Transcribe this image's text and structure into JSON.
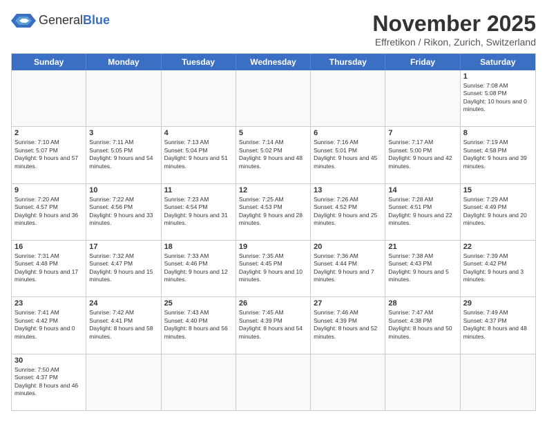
{
  "header": {
    "logo_general": "General",
    "logo_blue": "Blue",
    "month_title": "November 2025",
    "location": "Effretikon / Rikon, Zurich, Switzerland"
  },
  "days_of_week": [
    "Sunday",
    "Monday",
    "Tuesday",
    "Wednesday",
    "Thursday",
    "Friday",
    "Saturday"
  ],
  "weeks": [
    [
      {
        "day": "",
        "empty": true
      },
      {
        "day": "",
        "empty": true
      },
      {
        "day": "",
        "empty": true
      },
      {
        "day": "",
        "empty": true
      },
      {
        "day": "",
        "empty": true
      },
      {
        "day": "",
        "empty": true
      },
      {
        "day": "1",
        "sunrise": "7:08 AM",
        "sunset": "5:08 PM",
        "daylight": "10 hours and 0 minutes."
      }
    ],
    [
      {
        "day": "2",
        "sunrise": "7:10 AM",
        "sunset": "5:07 PM",
        "daylight": "9 hours and 57 minutes."
      },
      {
        "day": "3",
        "sunrise": "7:11 AM",
        "sunset": "5:05 PM",
        "daylight": "9 hours and 54 minutes."
      },
      {
        "day": "4",
        "sunrise": "7:13 AM",
        "sunset": "5:04 PM",
        "daylight": "9 hours and 51 minutes."
      },
      {
        "day": "5",
        "sunrise": "7:14 AM",
        "sunset": "5:02 PM",
        "daylight": "9 hours and 48 minutes."
      },
      {
        "day": "6",
        "sunrise": "7:16 AM",
        "sunset": "5:01 PM",
        "daylight": "9 hours and 45 minutes."
      },
      {
        "day": "7",
        "sunrise": "7:17 AM",
        "sunset": "5:00 PM",
        "daylight": "9 hours and 42 minutes."
      },
      {
        "day": "8",
        "sunrise": "7:19 AM",
        "sunset": "4:58 PM",
        "daylight": "9 hours and 39 minutes."
      }
    ],
    [
      {
        "day": "9",
        "sunrise": "7:20 AM",
        "sunset": "4:57 PM",
        "daylight": "9 hours and 36 minutes."
      },
      {
        "day": "10",
        "sunrise": "7:22 AM",
        "sunset": "4:56 PM",
        "daylight": "9 hours and 33 minutes."
      },
      {
        "day": "11",
        "sunrise": "7:23 AM",
        "sunset": "4:54 PM",
        "daylight": "9 hours and 31 minutes."
      },
      {
        "day": "12",
        "sunrise": "7:25 AM",
        "sunset": "4:53 PM",
        "daylight": "9 hours and 28 minutes."
      },
      {
        "day": "13",
        "sunrise": "7:26 AM",
        "sunset": "4:52 PM",
        "daylight": "9 hours and 25 minutes."
      },
      {
        "day": "14",
        "sunrise": "7:28 AM",
        "sunset": "4:51 PM",
        "daylight": "9 hours and 22 minutes."
      },
      {
        "day": "15",
        "sunrise": "7:29 AM",
        "sunset": "4:49 PM",
        "daylight": "9 hours and 20 minutes."
      }
    ],
    [
      {
        "day": "16",
        "sunrise": "7:31 AM",
        "sunset": "4:48 PM",
        "daylight": "9 hours and 17 minutes."
      },
      {
        "day": "17",
        "sunrise": "7:32 AM",
        "sunset": "4:47 PM",
        "daylight": "9 hours and 15 minutes."
      },
      {
        "day": "18",
        "sunrise": "7:33 AM",
        "sunset": "4:46 PM",
        "daylight": "9 hours and 12 minutes."
      },
      {
        "day": "19",
        "sunrise": "7:35 AM",
        "sunset": "4:45 PM",
        "daylight": "9 hours and 10 minutes."
      },
      {
        "day": "20",
        "sunrise": "7:36 AM",
        "sunset": "4:44 PM",
        "daylight": "9 hours and 7 minutes."
      },
      {
        "day": "21",
        "sunrise": "7:38 AM",
        "sunset": "4:43 PM",
        "daylight": "9 hours and 5 minutes."
      },
      {
        "day": "22",
        "sunrise": "7:39 AM",
        "sunset": "4:42 PM",
        "daylight": "9 hours and 3 minutes."
      }
    ],
    [
      {
        "day": "23",
        "sunrise": "7:41 AM",
        "sunset": "4:42 PM",
        "daylight": "9 hours and 0 minutes."
      },
      {
        "day": "24",
        "sunrise": "7:42 AM",
        "sunset": "4:41 PM",
        "daylight": "8 hours and 58 minutes."
      },
      {
        "day": "25",
        "sunrise": "7:43 AM",
        "sunset": "4:40 PM",
        "daylight": "8 hours and 56 minutes."
      },
      {
        "day": "26",
        "sunrise": "7:45 AM",
        "sunset": "4:39 PM",
        "daylight": "8 hours and 54 minutes."
      },
      {
        "day": "27",
        "sunrise": "7:46 AM",
        "sunset": "4:39 PM",
        "daylight": "8 hours and 52 minutes."
      },
      {
        "day": "28",
        "sunrise": "7:47 AM",
        "sunset": "4:38 PM",
        "daylight": "8 hours and 50 minutes."
      },
      {
        "day": "29",
        "sunrise": "7:49 AM",
        "sunset": "4:37 PM",
        "daylight": "8 hours and 48 minutes."
      }
    ],
    [
      {
        "day": "30",
        "sunrise": "7:50 AM",
        "sunset": "4:37 PM",
        "daylight": "8 hours and 46 minutes."
      },
      {
        "day": "",
        "empty": true
      },
      {
        "day": "",
        "empty": true
      },
      {
        "day": "",
        "empty": true
      },
      {
        "day": "",
        "empty": true
      },
      {
        "day": "",
        "empty": true
      },
      {
        "day": "",
        "empty": true
      }
    ]
  ]
}
